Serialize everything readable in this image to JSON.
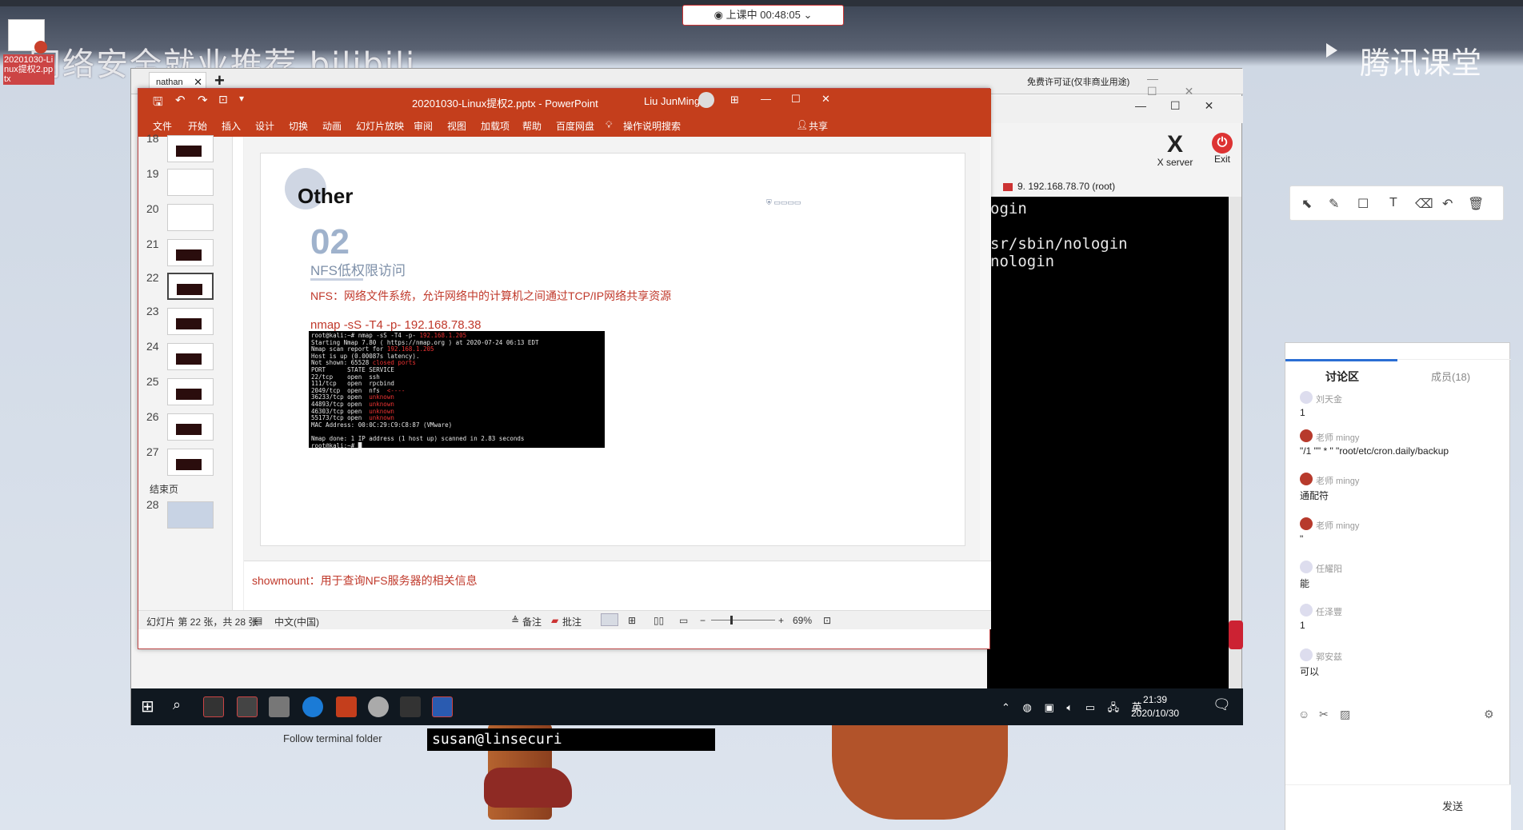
{
  "stage": {
    "watermark": "网络安全就业推荐 bilibili",
    "brand": "腾讯课堂",
    "live_status": "◉ 上课中 00:48:05 ⌄",
    "desktop_icon_label": "20201030-Linux提权2.pptx"
  },
  "vm": {
    "tab_label": "nathan",
    "tab_close": "✕",
    "add_tab": "+",
    "license": "免费许可证(仅非商业用途)",
    "controls": [
      "—",
      "☐",
      "✕"
    ],
    "xserver_label": "X server",
    "exit_label": "Exit",
    "terminal_tab": "9. 192.168.78.70 (root)",
    "terminal_lines": [
      "ogin",
      "",
      "sr/sbin/nologin",
      "nologin"
    ],
    "bg_terminal": "susan@linsecuri",
    "bg_folder": "Follow terminal folder"
  },
  "ppt": {
    "title": "20201030-Linux提权2.pptx  -  PowerPoint",
    "user": "Liu JunMing",
    "ribbon": [
      "文件",
      "开始",
      "插入",
      "设计",
      "切换",
      "动画",
      "幻灯片放映",
      "审阅",
      "视图",
      "加载项",
      "帮助",
      "百度网盘"
    ],
    "search": "操作说明搜索",
    "share": "共享",
    "thumbs": [
      {
        "num": "18"
      },
      {
        "num": "19"
      },
      {
        "num": "20"
      },
      {
        "num": "21"
      },
      {
        "num": "22"
      },
      {
        "num": "23"
      },
      {
        "num": "24"
      },
      {
        "num": "25"
      },
      {
        "num": "26"
      },
      {
        "num": "27"
      },
      {
        "num": "28"
      }
    ],
    "section_end": "结束页",
    "slide": {
      "heading": "Other",
      "number": "02",
      "subtitle": "NFS低权限访问",
      "desc": "NFS：网络文件系统，允许网络中的计算机之间通过TCP/IP网络共享资源",
      "cmd": "nmap -sS -T4 -p- 192.168.78.38"
    },
    "notes": "showmount：用于查询NFS服务器的相关信息",
    "status": {
      "slide_info": "幻灯片 第 22 张，共 28 张",
      "lang": "中文(中国)",
      "notes_btn": "备注",
      "comments_btn": "批注",
      "zoom": "69%"
    }
  },
  "taskbar": {
    "time": "21:39",
    "date": "2020/10/30",
    "ime": "英"
  },
  "chat": {
    "tab": "讨论区",
    "members": "成员(18)",
    "messages": [
      {
        "name": "刘天金",
        "text": "1"
      },
      {
        "name": "老师  mingy",
        "text": "\"/1 \"\" * \" \"root/etc/cron.daily/backup"
      },
      {
        "name": "老师  mingy",
        "text": "通配符"
      },
      {
        "name": "老师  mingy",
        "text": "\""
      },
      {
        "name": "任耀阳",
        "text": "能"
      },
      {
        "name": "任泽豐",
        "text": "1"
      },
      {
        "name": "郭安兹",
        "text": "可以"
      }
    ],
    "send": "发送"
  }
}
